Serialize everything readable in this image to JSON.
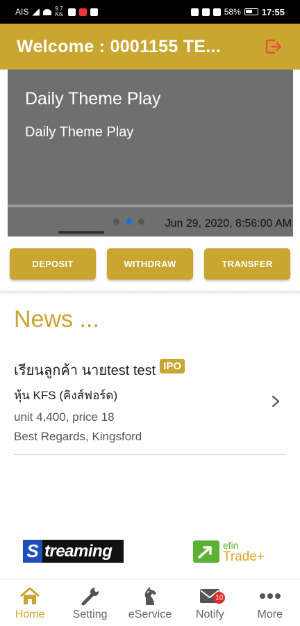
{
  "status_bar": {
    "carrier": "AIS",
    "speed": "9.7 K/s",
    "battery": "58%",
    "time": "17:55"
  },
  "header": {
    "title": "Welcome : 0001155 TE...",
    "logout_icon": "logout-icon"
  },
  "banner": {
    "title": "Daily Theme Play",
    "subtitle": "Daily Theme Play",
    "date": "Jun 29, 2020, 8:56:00 AM",
    "active_dot": 1,
    "dot_count": 3
  },
  "actions": {
    "deposit": "DEPOSIT",
    "withdraw": "WITHDRAW",
    "transfer": "TRANSFER"
  },
  "news": {
    "title": "News ...",
    "items": [
      {
        "line1": "เรียนลูกค้า นายtest test",
        "badge": "IPO",
        "line2": "หุ้น KFS (คิงส์ฟอร์ด)",
        "line3": "unit 4,400, price 18",
        "line4": "Best Regards, Kingsford"
      }
    ]
  },
  "partners": {
    "streaming_letter": "S",
    "streaming_text": "treaming",
    "efin_top": "efin",
    "efin_bottom": "Trade+"
  },
  "bottom_nav": {
    "items": [
      {
        "label": "Home",
        "icon": "home-icon",
        "active": true
      },
      {
        "label": "Setting",
        "icon": "wrench-icon"
      },
      {
        "label": "eService",
        "icon": "horse-icon"
      },
      {
        "label": "Notify",
        "icon": "mail-icon",
        "badge": "10"
      },
      {
        "label": "More",
        "icon": "more-icon"
      }
    ]
  },
  "colors": {
    "brand_gold": "#c8a630",
    "banner_gray": "#6f6f6f",
    "logout_red": "#e8503a",
    "active_dot": "#1f6fd6"
  }
}
